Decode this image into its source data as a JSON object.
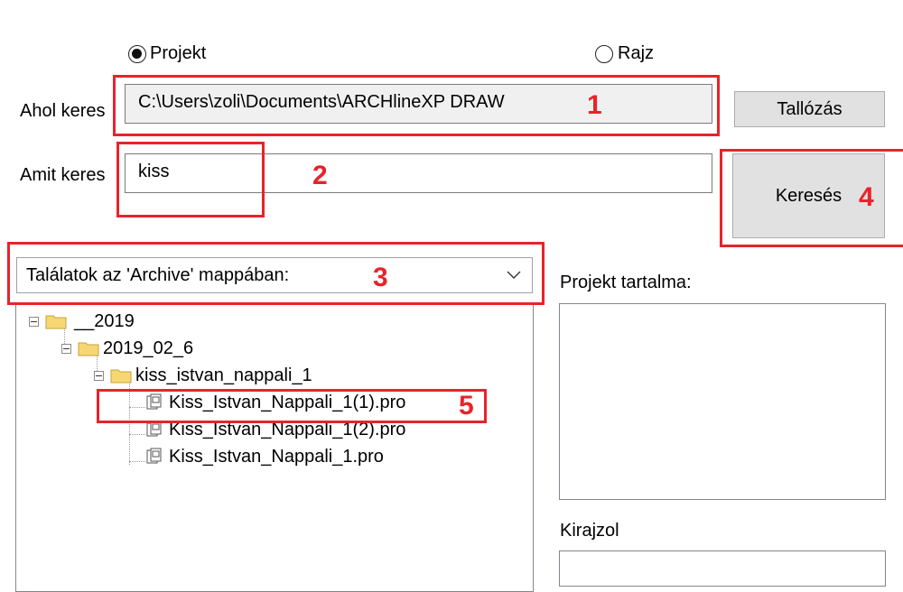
{
  "search_scope": {
    "radio_project": {
      "label": "Projekt",
      "checked": true
    },
    "radio_drawing": {
      "label": "Rajz",
      "checked": false
    }
  },
  "where": {
    "label": "Ahol keres",
    "value": "C:\\Users\\zoli\\Documents\\ARCHlineXP DRAW",
    "browse_label": "Tallózás"
  },
  "what": {
    "label": "Amit keres",
    "value": "kiss",
    "search_label": "Keresés"
  },
  "results": {
    "dropdown_value": "Találatok az 'Archive' mappában:",
    "tree": [
      {
        "label": "__2019",
        "type": "folder"
      },
      {
        "label": "2019_02_6",
        "type": "folder"
      },
      {
        "label": "kiss_istvan_nappali_1",
        "type": "folder"
      },
      {
        "label": "Kiss_Istvan_Nappali_1(1).pro",
        "type": "file"
      },
      {
        "label": "Kiss_Istvan_Nappali_1(2).pro",
        "type": "file"
      },
      {
        "label": "Kiss_Istvan_Nappali_1.pro",
        "type": "file"
      }
    ]
  },
  "right_panel": {
    "project_content_label": "Projekt tartalma:",
    "draw_label": "Kirajzol"
  },
  "annotations": [
    "1",
    "2",
    "3",
    "4",
    "5"
  ],
  "colors": {
    "annotation": "#e8232a",
    "button": "#e1e1e1"
  }
}
